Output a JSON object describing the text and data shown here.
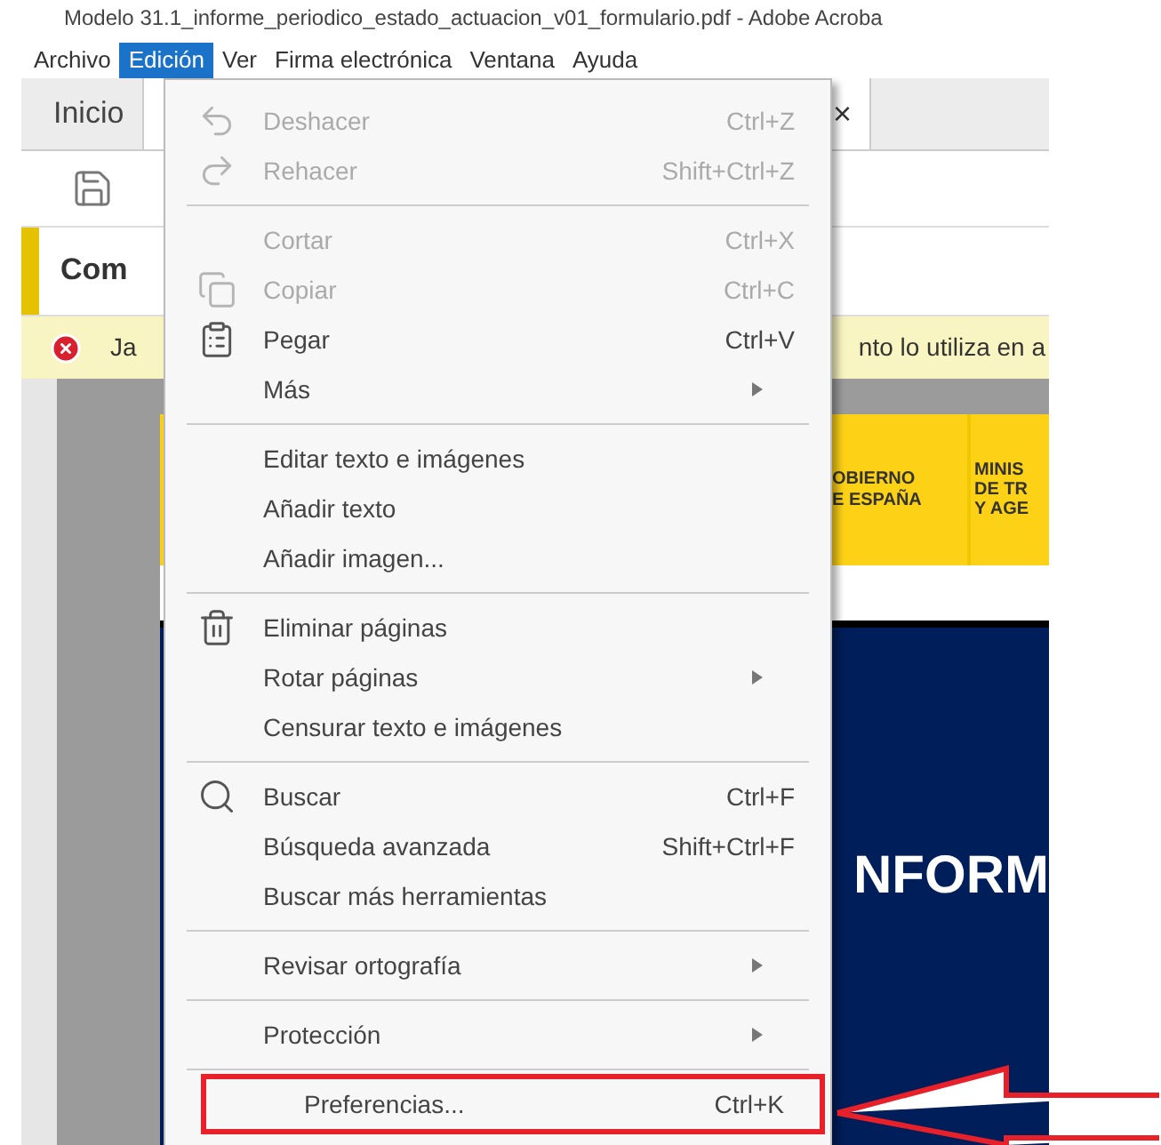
{
  "window": {
    "title": "Modelo 31.1_informe_periodico_estado_actuacion_v01_formulario.pdf - Adobe Acroba"
  },
  "menu_bar": [
    {
      "label": "Archivo",
      "selected": false
    },
    {
      "label": "Edición",
      "selected": true
    },
    {
      "label": "Ver",
      "selected": false
    },
    {
      "label": "Firma electrónica",
      "selected": false
    },
    {
      "label": "Ventana",
      "selected": false
    },
    {
      "label": "Ayuda",
      "selected": false
    }
  ],
  "tabs": [
    {
      "label": "Inicio"
    },
    {
      "close": "×"
    }
  ],
  "tool_panel": {
    "title": "Com"
  },
  "warning": {
    "left": "Ja",
    "right": "nto lo utiliza en a"
  },
  "document": {
    "header_1": [
      "OBIERNO",
      "E ESPAÑA"
    ],
    "header_2": [
      "MINIS",
      "DE TR",
      "Y AGE"
    ],
    "banner": "NFORM"
  },
  "menu": [
    {
      "kind": "undo",
      "label": "Deshacer",
      "shortcut": "Ctrl+Z",
      "disabled": true,
      "submenu": false,
      "annotated": false
    },
    {
      "kind": "redo",
      "label": "Rehacer",
      "shortcut": "Shift+Ctrl+Z",
      "disabled": true,
      "submenu": false,
      "annotated": false
    },
    {
      "kind": "separator"
    },
    {
      "kind": "item",
      "label": "Cortar",
      "shortcut": "Ctrl+X",
      "disabled": true,
      "submenu": false,
      "annotated": false
    },
    {
      "kind": "copy",
      "label": "Copiar",
      "shortcut": "Ctrl+C",
      "disabled": true,
      "submenu": false,
      "annotated": false
    },
    {
      "kind": "paste",
      "label": "Pegar",
      "shortcut": "Ctrl+V",
      "disabled": false,
      "submenu": false,
      "annotated": false
    },
    {
      "kind": "item",
      "label": "Más",
      "disabled": false,
      "submenu": true,
      "annotated": false
    },
    {
      "kind": "separator"
    },
    {
      "kind": "item",
      "label": "Editar texto e imágenes",
      "disabled": false,
      "submenu": false,
      "annotated": false
    },
    {
      "kind": "item",
      "label": "Añadir texto",
      "disabled": false,
      "submenu": false,
      "annotated": false
    },
    {
      "kind": "item",
      "label": "Añadir imagen...",
      "disabled": false,
      "submenu": false,
      "annotated": false
    },
    {
      "kind": "separator"
    },
    {
      "kind": "trash",
      "label": "Eliminar páginas",
      "disabled": false,
      "submenu": false,
      "annotated": false
    },
    {
      "kind": "item",
      "label": "Rotar páginas",
      "disabled": false,
      "submenu": true,
      "annotated": false
    },
    {
      "kind": "item",
      "label": "Censurar texto e imágenes",
      "disabled": false,
      "submenu": false,
      "annotated": false
    },
    {
      "kind": "separator"
    },
    {
      "kind": "search",
      "label": "Buscar",
      "shortcut": "Ctrl+F",
      "disabled": false,
      "submenu": false,
      "annotated": false
    },
    {
      "kind": "item",
      "label": "Búsqueda avanzada",
      "shortcut": "Shift+Ctrl+F",
      "disabled": false,
      "submenu": false,
      "annotated": false
    },
    {
      "kind": "item",
      "label": "Buscar más herramientas",
      "disabled": false,
      "submenu": false,
      "annotated": false
    },
    {
      "kind": "separator"
    },
    {
      "kind": "item",
      "label": "Revisar ortografía",
      "disabled": false,
      "submenu": true,
      "annotated": false
    },
    {
      "kind": "separator"
    },
    {
      "kind": "item",
      "label": "Protección",
      "disabled": false,
      "submenu": true,
      "annotated": false
    },
    {
      "kind": "separator"
    },
    {
      "kind": "item",
      "label": "Preferencias...",
      "shortcut": "Ctrl+K",
      "disabled": false,
      "submenu": false,
      "annotated": true
    }
  ]
}
